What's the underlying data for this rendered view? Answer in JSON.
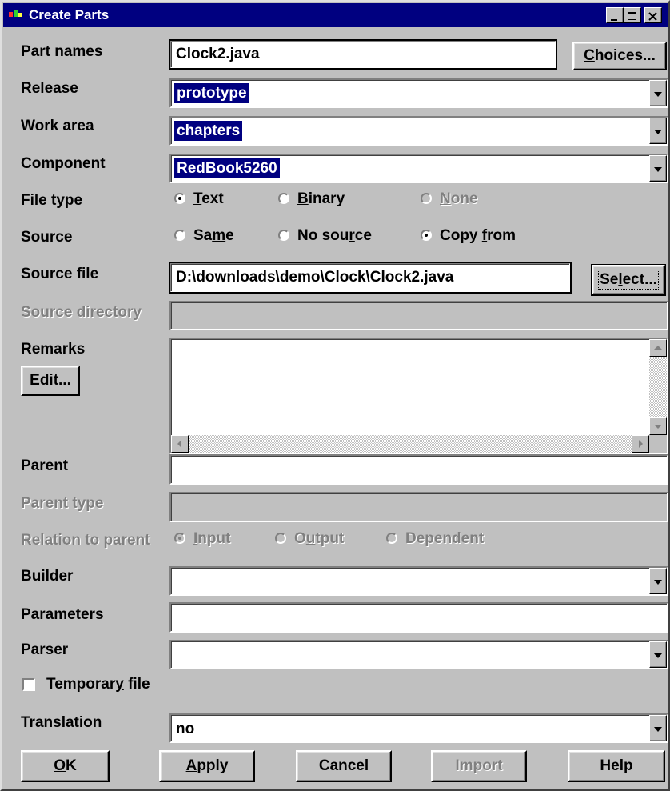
{
  "window": {
    "title": "Create Parts"
  },
  "labels": {
    "part_names": "Part names",
    "release": "Release",
    "work_area": "Work area",
    "component": "Component",
    "file_type": "File type",
    "source": "Source",
    "source_file": "Source file",
    "source_directory": "Source directory",
    "remarks": "Remarks",
    "parent": "Parent",
    "parent_type": "Parent type",
    "relation_to_parent": "Relation to parent",
    "builder": "Builder",
    "parameters": "Parameters",
    "parser": "Parser",
    "translation": "Translation"
  },
  "fields": {
    "part_names": "Clock2.java",
    "release": "prototype",
    "work_area": "chapters",
    "component": "RedBook5260",
    "source_file": "D:\\downloads\\demo\\Clock\\Clock2.java",
    "source_directory": "",
    "remarks": "",
    "parent": "",
    "parent_type": "",
    "builder": "",
    "parameters": "",
    "parser": "",
    "translation": "no"
  },
  "file_type_options": [
    {
      "pre": "",
      "ul": "T",
      "post": "ext",
      "selected": true,
      "enabled": true
    },
    {
      "pre": "",
      "ul": "B",
      "post": "inary",
      "selected": false,
      "enabled": true
    },
    {
      "pre": "",
      "ul": "N",
      "post": "one",
      "selected": false,
      "enabled": false
    }
  ],
  "source_options": [
    {
      "pre": "Sa",
      "ul": "m",
      "post": "e",
      "selected": false
    },
    {
      "pre": "No sou",
      "ul": "r",
      "post": "ce",
      "selected": false
    },
    {
      "pre": "Copy ",
      "ul": "f",
      "post": "rom",
      "selected": true
    }
  ],
  "relation_options": [
    {
      "pre": "",
      "ul": "I",
      "post": "nput",
      "selected": true
    },
    {
      "pre": "O",
      "ul": "u",
      "post": "tput",
      "selected": false
    },
    {
      "pre": "",
      "ul": "",
      "post": "Dependent",
      "selected": false
    }
  ],
  "temporary_file": {
    "pre": "Temporar",
    "ul": "y",
    "post": " file",
    "checked": false
  },
  "buttons": {
    "choices": {
      "pre": "",
      "ul": "C",
      "post": "hoices..."
    },
    "select": {
      "pre": "Se",
      "ul": "l",
      "post": "ect..."
    },
    "edit": {
      "pre": "",
      "ul": "E",
      "post": "dit..."
    },
    "ok": {
      "pre": "",
      "ul": "O",
      "post": "K"
    },
    "apply": {
      "pre": "",
      "ul": "A",
      "post": "pply"
    },
    "cancel": {
      "pre": "",
      "ul": "",
      "post": "Cancel"
    },
    "import": {
      "pre": "",
      "ul": "",
      "post": "Import"
    },
    "help": {
      "pre": "",
      "ul": "",
      "post": "Help"
    }
  }
}
